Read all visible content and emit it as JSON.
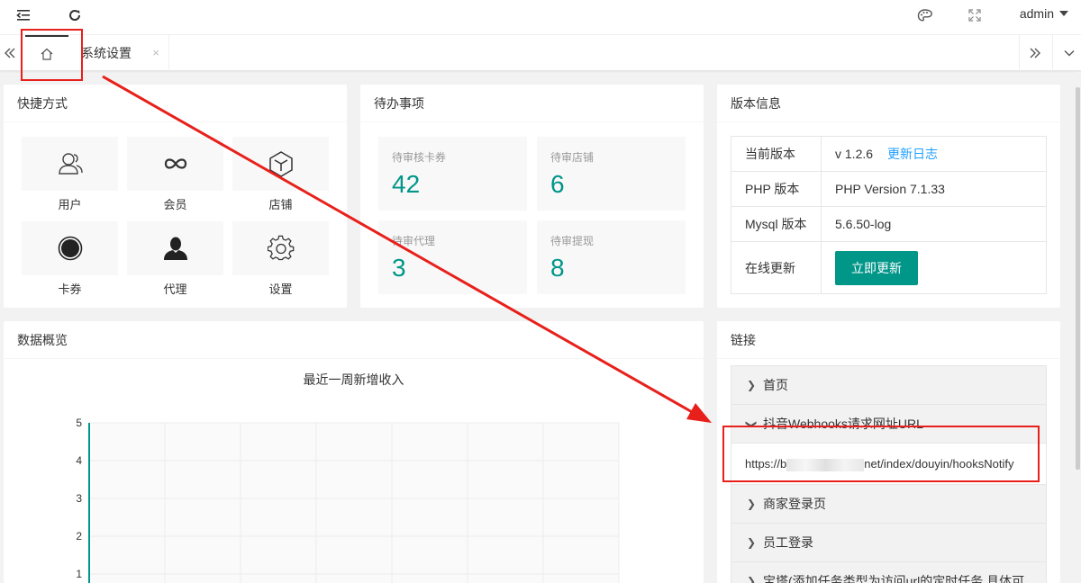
{
  "header": {
    "user": "admin"
  },
  "tabs": {
    "items": [
      {
        "label": "系统设置",
        "close": "×"
      }
    ]
  },
  "shortcuts": {
    "title": "快捷方式",
    "items": [
      {
        "label": "用户",
        "icon": "user-icon"
      },
      {
        "label": "会员",
        "icon": "infinity-icon"
      },
      {
        "label": "店铺",
        "icon": "cube-icon"
      },
      {
        "label": "卡券",
        "icon": "record-icon"
      },
      {
        "label": "代理",
        "icon": "person-icon"
      },
      {
        "label": "设置",
        "icon": "gear-icon"
      }
    ]
  },
  "todo": {
    "title": "待办事项",
    "items": [
      {
        "label": "待审核卡券",
        "value": "42"
      },
      {
        "label": "待审店铺",
        "value": "6"
      },
      {
        "label": "待审代理",
        "value": "3"
      },
      {
        "label": "待审提现",
        "value": "8"
      }
    ]
  },
  "version": {
    "title": "版本信息",
    "rows": {
      "current_label": "当前版本",
      "current_value": "v 1.2.6",
      "changelog": "更新日志",
      "php_label": "PHP 版本",
      "php_value": "PHP Version 7.1.33",
      "mysql_label": "Mysql 版本",
      "mysql_value": "5.6.50-log",
      "update_label": "在线更新",
      "update_button": "立即更新"
    }
  },
  "overview": {
    "title": "数据概览"
  },
  "chart_data": {
    "type": "line",
    "title": "最近一周新增收入",
    "ylim": [
      0,
      5
    ],
    "yticks": [
      "5",
      "4",
      "3",
      "2",
      "1"
    ],
    "grid": true,
    "series": []
  },
  "links": {
    "title": "链接",
    "items": [
      {
        "label": "首页",
        "expanded": false
      },
      {
        "label": "抖音Webhooks请求网址URL",
        "expanded": true,
        "content_prefix": "https://b",
        "content_suffix": "net/index/douyin/hooksNotify"
      },
      {
        "label": "商家登录页",
        "expanded": false
      },
      {
        "label": "员工登录",
        "expanded": false
      },
      {
        "label": "宝塔(添加任务类型为访问url的定时任务,具体可",
        "expanded": false
      }
    ]
  },
  "colors": {
    "accent": "#009688",
    "link": "#1e9fff",
    "annotation": "#e8201b"
  }
}
